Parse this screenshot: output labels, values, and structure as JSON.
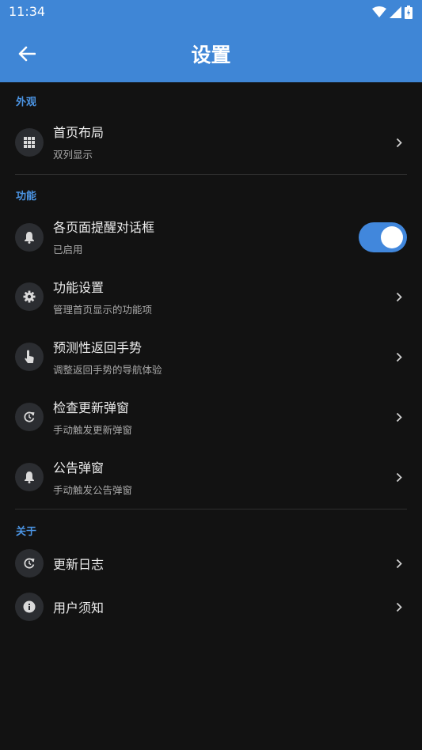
{
  "status_bar": {
    "time": "11:34"
  },
  "appbar": {
    "title": "设置"
  },
  "sections": {
    "appearance": {
      "header": "外观",
      "items": [
        {
          "title": "首页布局",
          "subtitle": "双列显示",
          "icon": "grid-icon"
        }
      ]
    },
    "features": {
      "header": "功能",
      "items": [
        {
          "title": "各页面提醒对话框",
          "subtitle": "已启用",
          "icon": "bell-icon",
          "toggle": true
        },
        {
          "title": "功能设置",
          "subtitle": "管理首页显示的功能项",
          "icon": "gear-icon"
        },
        {
          "title": "预测性返回手势",
          "subtitle": "调整返回手势的导航体验",
          "icon": "touch-icon"
        },
        {
          "title": "检查更新弹窗",
          "subtitle": "手动触发更新弹窗",
          "icon": "refresh-icon"
        },
        {
          "title": "公告弹窗",
          "subtitle": "手动触发公告弹窗",
          "icon": "bell-icon"
        }
      ]
    },
    "about": {
      "header": "关于",
      "items": [
        {
          "title": "更新日志",
          "icon": "refresh-icon"
        },
        {
          "title": "用户须知",
          "icon": "info-icon"
        }
      ]
    }
  },
  "colors": {
    "appbar": "#3f86d6",
    "accent": "#4b94e3",
    "background": "#121212",
    "toggle_on": "#4187dc"
  }
}
